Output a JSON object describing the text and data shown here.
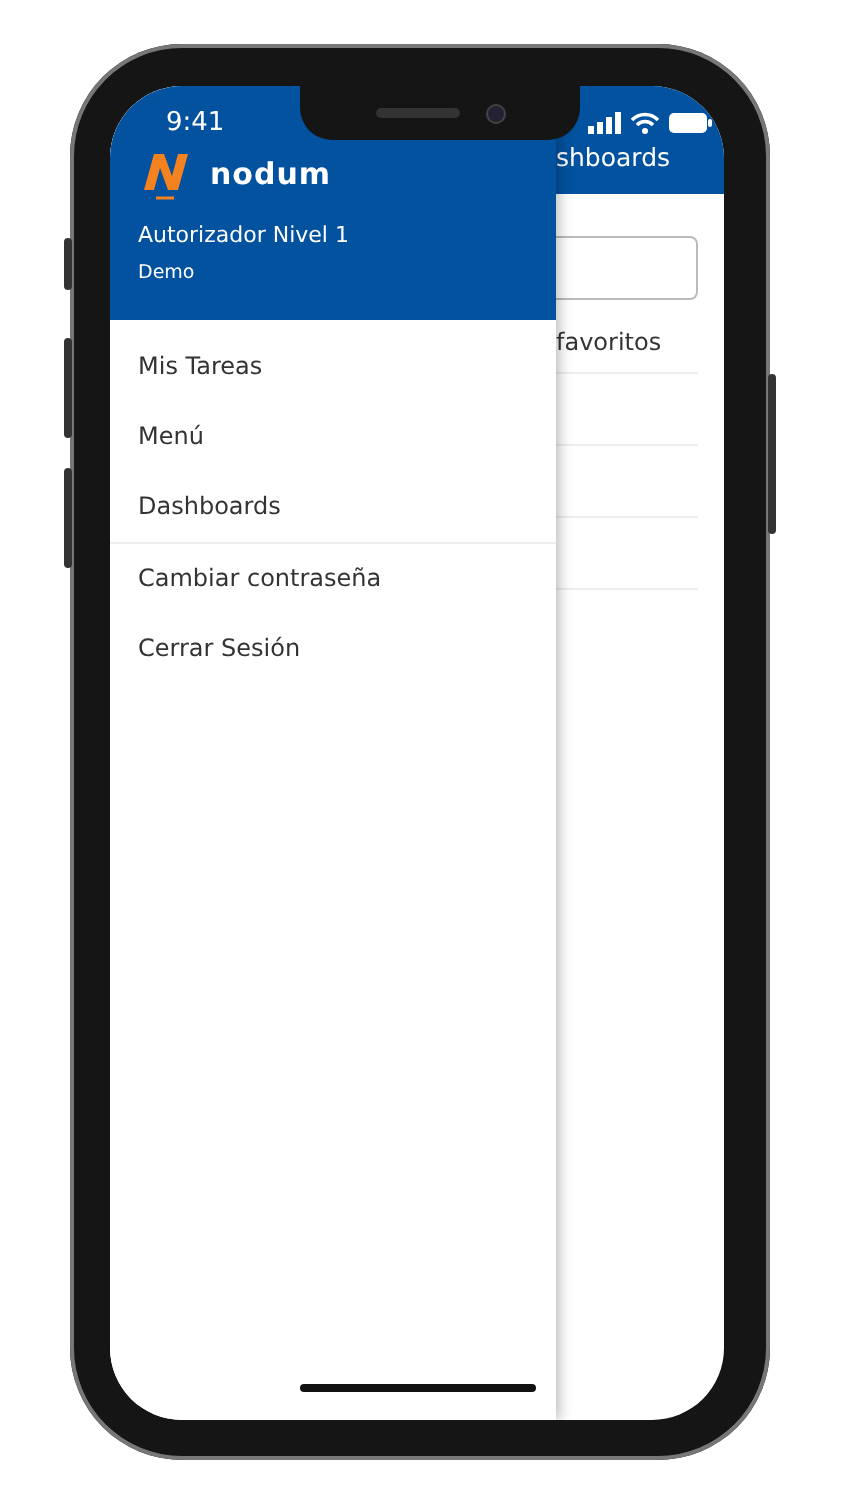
{
  "status_bar": {
    "time": "9:41"
  },
  "drawer": {
    "brand": "nodum",
    "user": "Autorizador Nivel 1",
    "company": "Demo",
    "sections": [
      [
        {
          "label": "Mis Tareas"
        },
        {
          "label": "Menú"
        },
        {
          "label": "Dashboards"
        }
      ],
      [
        {
          "label": "Cambiar contraseña"
        },
        {
          "label": "Cerrar Sesión"
        }
      ]
    ]
  },
  "background_page": {
    "title": "shboards",
    "section_label": "favoritos"
  }
}
